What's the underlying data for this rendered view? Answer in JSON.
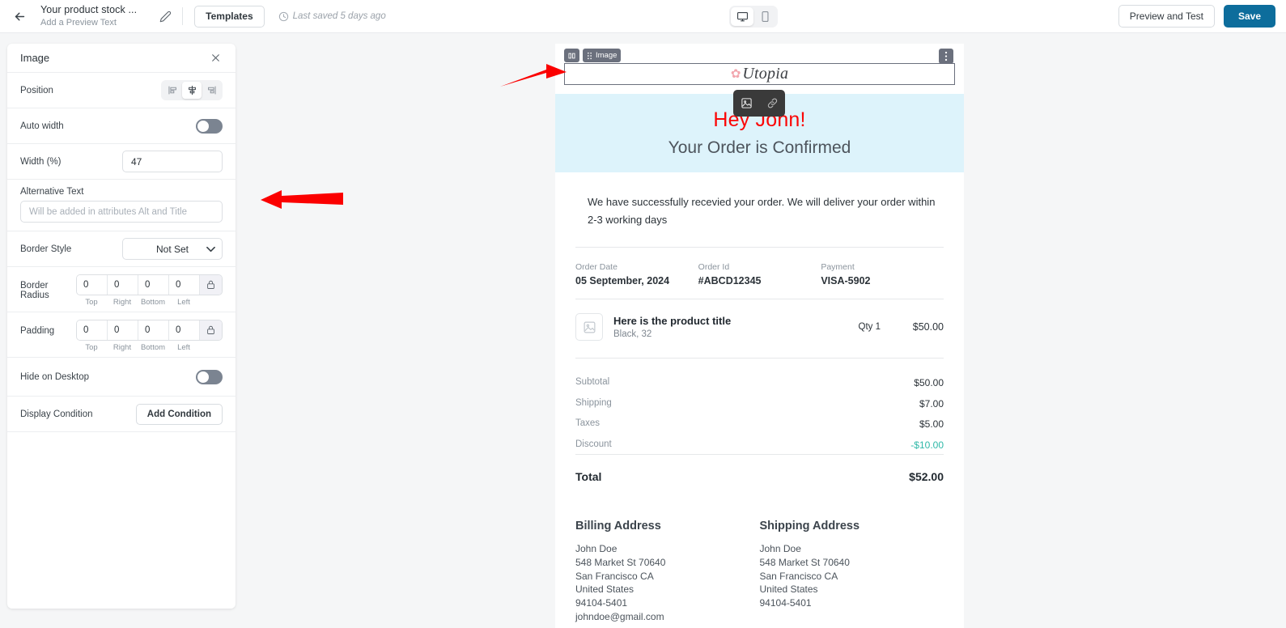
{
  "header": {
    "back_icon": "arrow-left-icon",
    "doc_title": "Your product stock ...",
    "doc_subtitle": "Add a Preview Text",
    "edit_icon": "pencil-icon",
    "templates_label": "Templates",
    "saved_icon": "clock-icon",
    "saved_text": "Last saved 5 days ago",
    "devices": [
      {
        "name": "desktop",
        "icon": "desktop-icon",
        "active": true
      },
      {
        "name": "mobile",
        "icon": "mobile-icon",
        "active": false
      }
    ],
    "preview_label": "Preview and Test",
    "save_label": "Save",
    "save_color": "#0d6d9c"
  },
  "panel": {
    "title": "Image",
    "close_icon": "close-icon",
    "position": {
      "label": "Position",
      "options": [
        {
          "name": "align-left",
          "icon": "align-left-icon",
          "active": false
        },
        {
          "name": "align-center",
          "icon": "align-center-icon",
          "active": true
        },
        {
          "name": "align-right",
          "icon": "align-right-icon",
          "active": false
        }
      ]
    },
    "auto_width": {
      "label": "Auto width",
      "value": "off"
    },
    "width": {
      "label": "Width (%)",
      "value": "47"
    },
    "alt_text": {
      "label": "Alternative Text",
      "value": "",
      "placeholder": "Will be added in attributes Alt and Title"
    },
    "border_style": {
      "label": "Border Style",
      "value": "Not Set",
      "chevron_icon": "chevron-down-icon"
    },
    "border_radius": {
      "label": "Border Radius",
      "values": [
        "0",
        "0",
        "0",
        "0"
      ],
      "captions": [
        "Top",
        "Right",
        "Bottom",
        "Left"
      ],
      "lock_icon": "lock-icon"
    },
    "padding": {
      "label": "Padding",
      "values": [
        "0",
        "0",
        "0",
        "0"
      ],
      "captions": [
        "Top",
        "Right",
        "Bottom",
        "Left"
      ],
      "lock_icon": "lock-icon"
    },
    "hide_on_desktop": {
      "label": "Hide on Desktop",
      "value": "off"
    },
    "display_condition": {
      "label": "Display Condition",
      "button_label": "Add Condition"
    }
  },
  "canvas": {
    "block_toolbar": {
      "columns_icon": "columns-icon",
      "drag_icon": "drag-handle-icon",
      "block_label": "Image",
      "menu_icon": "more-vertical-icon"
    },
    "float_tools": [
      {
        "name": "replace-image",
        "icon": "image-icon"
      },
      {
        "name": "add-link",
        "icon": "link-icon"
      }
    ],
    "logo": {
      "mark": "flower-icon",
      "text": "Utopia",
      "mark_color": "#f2a6ae"
    },
    "hero": {
      "greeting": "Hey John!",
      "greeting_color": "#fb0606",
      "subheading": "Your Order is Confirmed",
      "background": "#ddf3fb"
    },
    "body_copy": "We have successfully recevied your order. We will deliver your order within 2-3 working days",
    "order_meta": [
      {
        "key": "Order Date",
        "value": "05 September, 2024"
      },
      {
        "key": "Order Id",
        "value": "#ABCD12345"
      },
      {
        "key": "Payment",
        "value": "VISA-5902"
      }
    ],
    "product": {
      "thumb_icon": "image-placeholder-icon",
      "title": "Here is the product title",
      "variant": "Black, 32",
      "qty": "Qty 1",
      "price": "$50.00"
    },
    "totals": [
      {
        "key": "Subtotal",
        "value": "$50.00",
        "negative": false
      },
      {
        "key": "Shipping",
        "value": "$7.00",
        "negative": false
      },
      {
        "key": "Taxes",
        "value": "$5.00",
        "negative": false
      },
      {
        "key": "Discount",
        "value": "-$10.00",
        "negative": true
      }
    ],
    "discount_color": "#2fb8a8",
    "grand_total": {
      "key": "Total",
      "value": "$52.00"
    },
    "addresses": [
      {
        "heading": "Billing Address",
        "lines": [
          "John Doe",
          "548 Market St 70640",
          "San Francisco CA",
          "United States",
          "94104-5401",
          "johndoe@gmail.com"
        ]
      },
      {
        "heading": "Shipping Address",
        "lines": [
          "John Doe",
          "548 Market St 70640",
          "San Francisco CA",
          "United States",
          "94104-5401"
        ]
      }
    ]
  },
  "annotations": [
    {
      "name": "arrow-pointing-to-image-block",
      "direction": "right",
      "color": "#fb0000"
    },
    {
      "name": "arrow-pointing-to-alt-text-field",
      "direction": "left",
      "color": "#fb0000"
    }
  ]
}
